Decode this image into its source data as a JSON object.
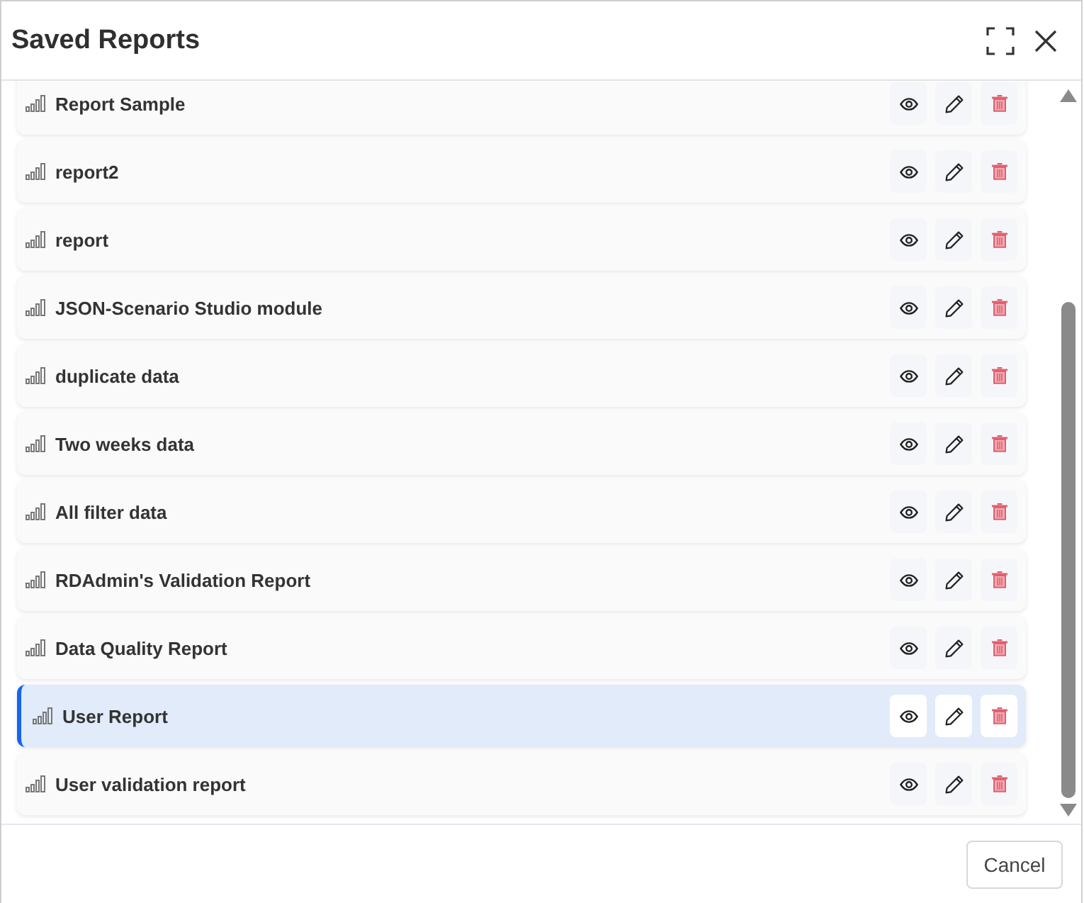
{
  "dialog": {
    "title": "Saved Reports"
  },
  "reports": [
    {
      "name": "Report Sample",
      "selected": false
    },
    {
      "name": "report2",
      "selected": false
    },
    {
      "name": "report",
      "selected": false
    },
    {
      "name": "JSON-Scenario Studio module",
      "selected": false
    },
    {
      "name": "duplicate data",
      "selected": false
    },
    {
      "name": "Two weeks data",
      "selected": false
    },
    {
      "name": "All filter data",
      "selected": false
    },
    {
      "name": "RDAdmin's Validation Report",
      "selected": false
    },
    {
      "name": "Data Quality Report",
      "selected": false
    },
    {
      "name": "User Report",
      "selected": true
    },
    {
      "name": "User validation report",
      "selected": false
    }
  ],
  "footer": {
    "buttons": [
      {
        "label": "Cancel"
      }
    ]
  }
}
